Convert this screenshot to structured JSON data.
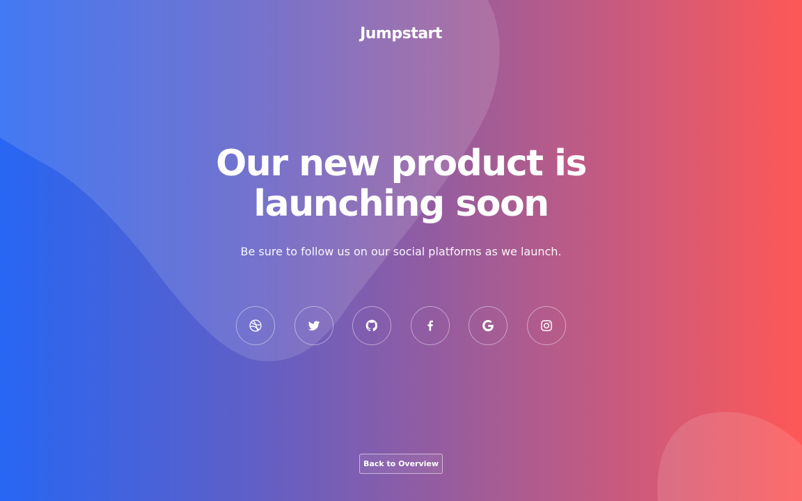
{
  "brand": {
    "name": "Jumpstart"
  },
  "hero": {
    "title": "Our new product is launching soon",
    "subtitle": "Be sure to follow us on our social platforms as we launch."
  },
  "social": [
    {
      "icon": "dribbble-icon"
    },
    {
      "icon": "twitter-icon"
    },
    {
      "icon": "github-icon"
    },
    {
      "icon": "facebook-icon"
    },
    {
      "icon": "google-icon"
    },
    {
      "icon": "instagram-icon"
    }
  ],
  "footer": {
    "back_label": "Back to Overview"
  },
  "colors": {
    "gradient_start": "#2766f3",
    "gradient_end": "#fe5856",
    "text": "#ffffff"
  }
}
